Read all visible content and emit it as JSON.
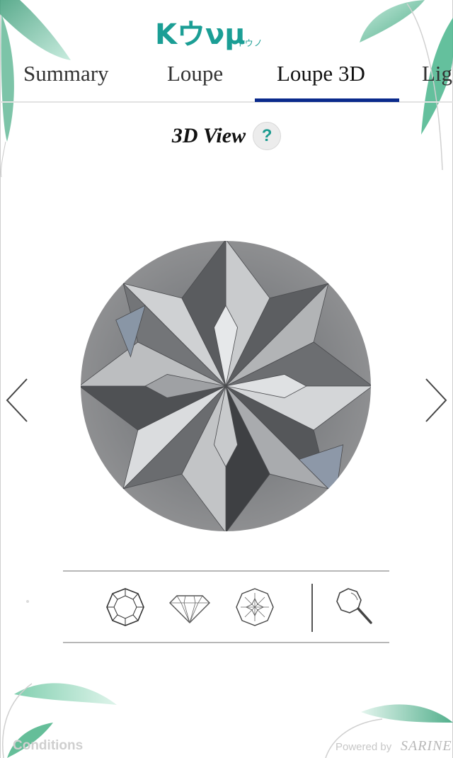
{
  "brand": {
    "logo_text": "Kウνμ",
    "logo_sub": "ケイウノ",
    "accent_color": "#1b9e95"
  },
  "tabs": [
    {
      "label": "Summary",
      "active": false
    },
    {
      "label": "Loupe",
      "active": false
    },
    {
      "label": "Loupe 3D",
      "active": true
    },
    {
      "label": "Lig",
      "active": false
    }
  ],
  "section": {
    "title": "3D View",
    "help_label": "?"
  },
  "navigation": {
    "prev_icon": "chevron-left-icon",
    "next_icon": "chevron-right-icon"
  },
  "toolbar": {
    "tools": [
      {
        "name": "top-view-icon"
      },
      {
        "name": "side-view-icon"
      },
      {
        "name": "bottom-view-icon"
      },
      {
        "name": "magnifier-icon"
      }
    ]
  },
  "footer": {
    "conditions_label": "Conditions",
    "powered_by": "Powered by",
    "provider": "SARINE"
  },
  "colors": {
    "tab_underline": "#0a2a8c",
    "leaf_green": "#5cc0a0"
  }
}
